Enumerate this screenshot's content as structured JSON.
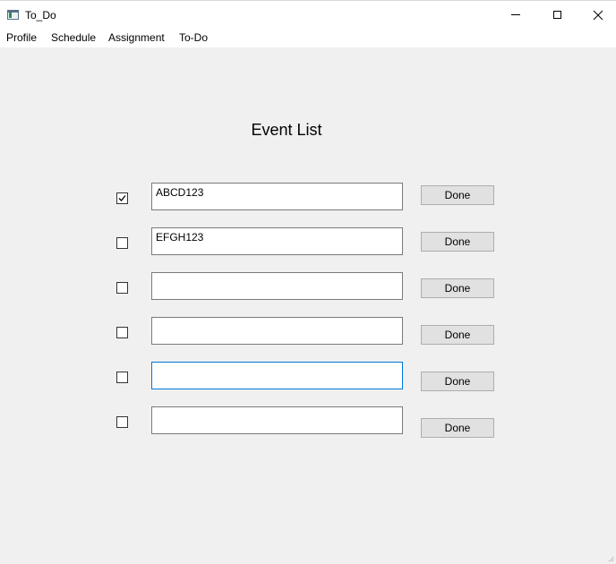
{
  "window": {
    "title": "To_Do",
    "icon": "app-window-icon"
  },
  "menu": {
    "items": [
      {
        "label": "Profile"
      },
      {
        "label": "Schedule"
      },
      {
        "label": "Assignment"
      },
      {
        "label": "To-Do"
      }
    ]
  },
  "main": {
    "heading": "Event List",
    "events": [
      {
        "checked": true,
        "value": "ABCD123",
        "button": "Done"
      },
      {
        "checked": false,
        "value": "EFGH123",
        "button": "Done"
      },
      {
        "checked": false,
        "value": "",
        "button": "Done"
      },
      {
        "checked": false,
        "value": "",
        "button": "Done"
      },
      {
        "checked": false,
        "value": "",
        "button": "Done",
        "focused": true
      },
      {
        "checked": false,
        "value": "",
        "button": "Done"
      }
    ]
  },
  "colors": {
    "background": "#f0f0f0",
    "focus_border": "#0078d7",
    "button_bg": "#e1e1e1"
  }
}
